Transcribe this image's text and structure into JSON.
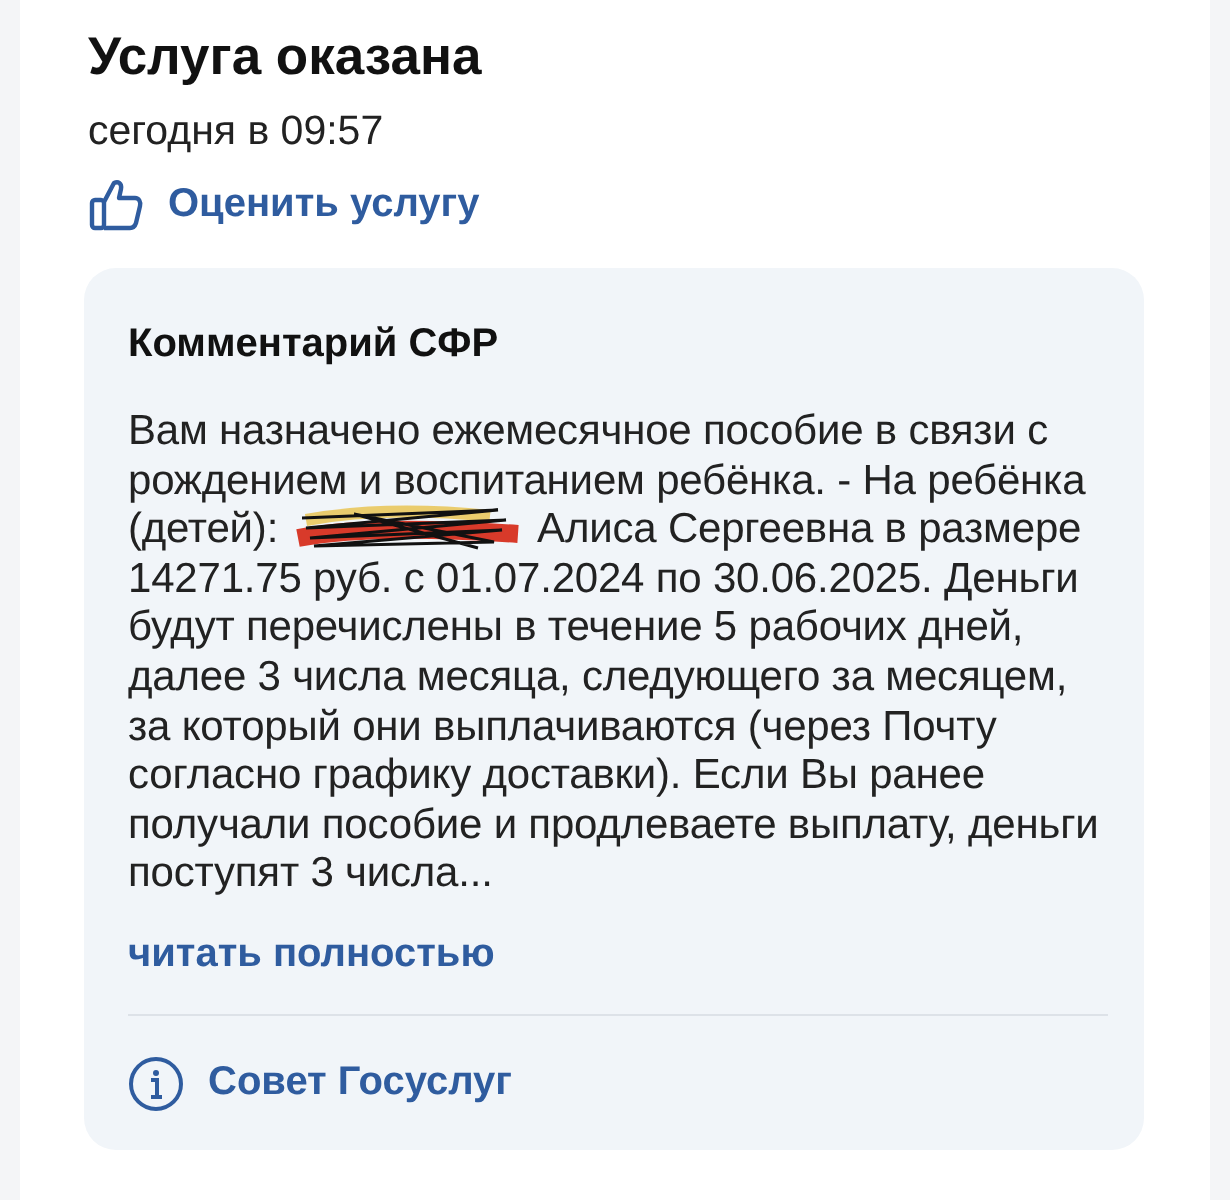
{
  "header": {
    "title": "Услуга оказана",
    "time": "сегодня в 09:57",
    "rate_link": "Оценить услугу"
  },
  "comment": {
    "title": "Комментарий СФР",
    "text_before_redaction": "Вам назначено ежемесячное пособие в связи с рождением и воспитанием ребёнка. - На ребёнка (детей):",
    "redacted": true,
    "text_after_redaction": "Алиса Сергеевна в размере 14271.75 руб. с 01.07.2024 по 30.06.2025. Деньги будут перечислены в течение 5 рабочих дней, далее 3 числа месяца, следующего за месяцем, за который они выплачиваются (через Почту согласно графику доставки). Если Вы ранее получали пособие и продлеваете выплату, деньги поступят 3 числа...",
    "read_more": "читать полностью",
    "tip_link": "Совет Госуслуг"
  }
}
